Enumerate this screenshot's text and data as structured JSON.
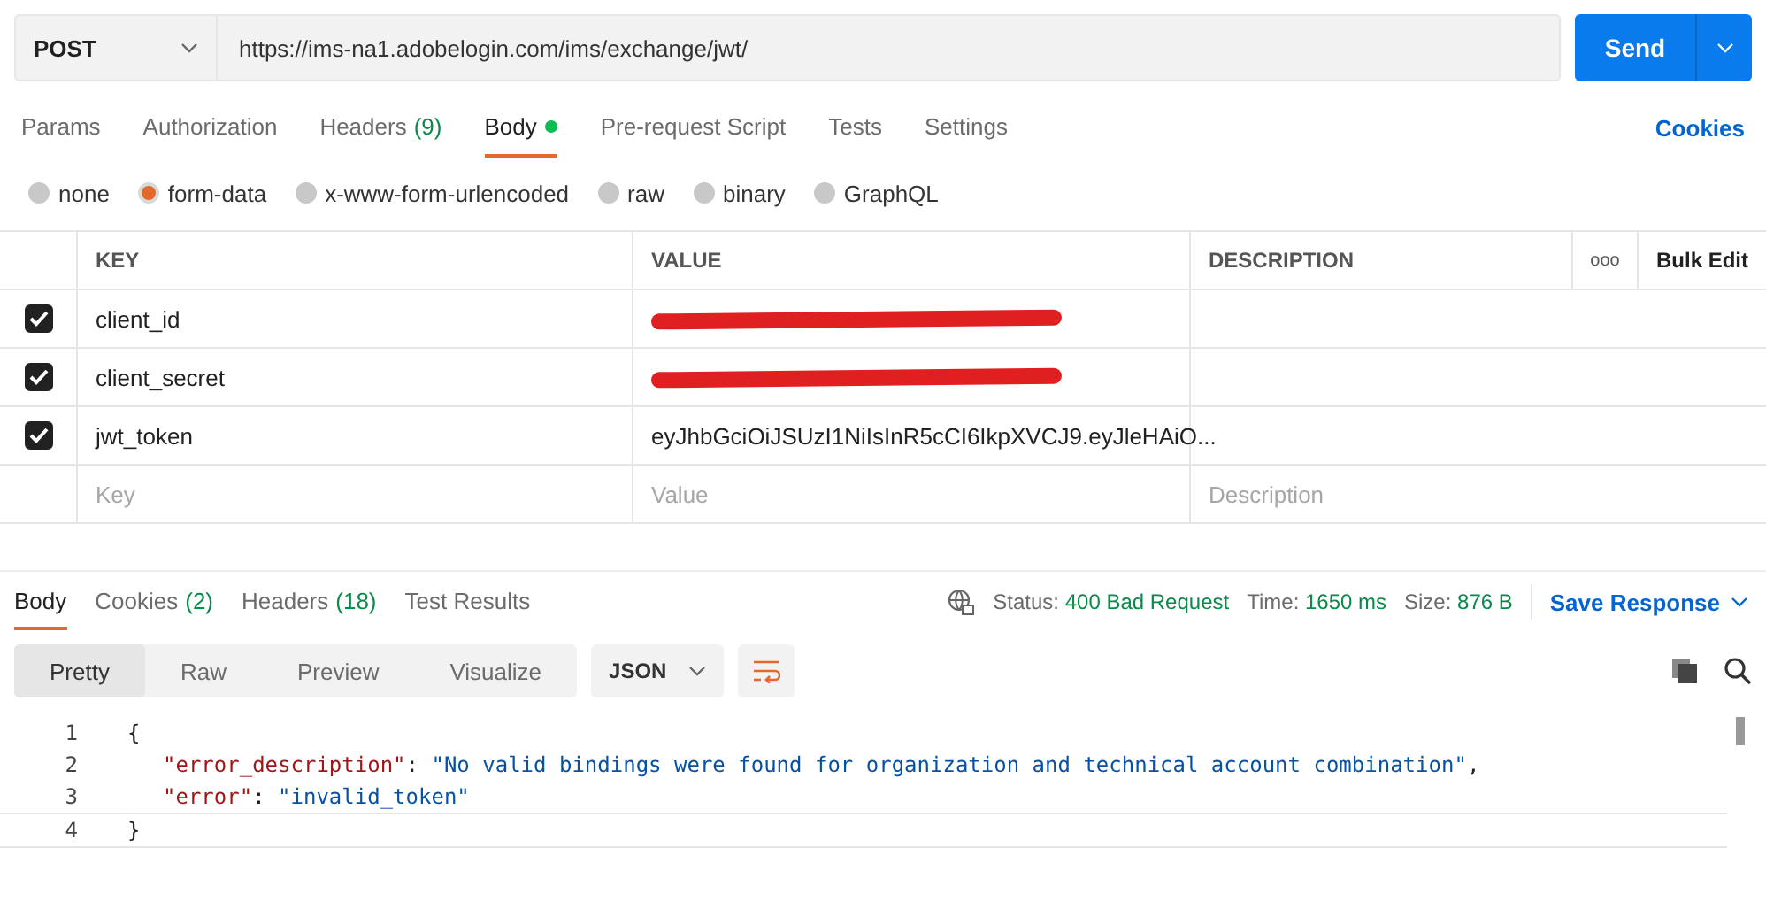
{
  "request": {
    "method": "POST",
    "url": "https://ims-na1.adobelogin.com/ims/exchange/jwt/",
    "send_label": "Send"
  },
  "request_tabs": [
    {
      "label": "Params",
      "selected": false
    },
    {
      "label": "Authorization",
      "selected": false
    },
    {
      "label": "Headers",
      "count": "(9)",
      "selected": false
    },
    {
      "label": "Body",
      "selected": true,
      "dot": true
    },
    {
      "label": "Pre-request Script",
      "selected": false
    },
    {
      "label": "Tests",
      "selected": false
    },
    {
      "label": "Settings",
      "selected": false
    }
  ],
  "cookies_link": "Cookies",
  "body_types": [
    {
      "label": "none",
      "selected": false
    },
    {
      "label": "form-data",
      "selected": true
    },
    {
      "label": "x-www-form-urlencoded",
      "selected": false
    },
    {
      "label": "raw",
      "selected": false
    },
    {
      "label": "binary",
      "selected": false
    },
    {
      "label": "GraphQL",
      "selected": false
    }
  ],
  "table": {
    "columns": [
      "KEY",
      "VALUE",
      "DESCRIPTION"
    ],
    "more": "ooo",
    "bulk_edit": "Bulk Edit",
    "rows": [
      {
        "key": "client_id",
        "checked": true,
        "redacted": true
      },
      {
        "key": "client_secret",
        "checked": true,
        "redacted": true
      },
      {
        "key": "jwt_token",
        "checked": true,
        "redacted": false,
        "value": "eyJhbGciOiJSUzI1NiIsInR5cCI6IkpXVCJ9.eyJleHAiO..."
      }
    ],
    "placeholders": {
      "key": "Key",
      "value": "Value",
      "description": "Description"
    }
  },
  "response_tabs": [
    {
      "label": "Body",
      "selected": true
    },
    {
      "label": "Cookies",
      "count": "(2)",
      "selected": false
    },
    {
      "label": "Headers",
      "count": "(18)",
      "selected": false
    },
    {
      "label": "Test Results",
      "selected": false
    }
  ],
  "status": [
    {
      "label": "Status:",
      "value": "400 Bad Request"
    },
    {
      "label": "Time:",
      "value": "1650 ms"
    },
    {
      "label": "Size:",
      "value": "876 B"
    }
  ],
  "save_response": "Save Response",
  "view_modes": [
    {
      "label": "Pretty",
      "selected": true
    },
    {
      "label": "Raw",
      "selected": false
    },
    {
      "label": "Preview",
      "selected": false
    },
    {
      "label": "Visualize",
      "selected": false
    }
  ],
  "format": "JSON",
  "code": [
    {
      "number": "1",
      "tokens": [
        {
          "kind": "punct",
          "text": "{"
        }
      ]
    },
    {
      "number": "2",
      "tokens": [
        {
          "kind": "key",
          "text": "\"error_description\""
        },
        {
          "kind": "punct",
          "text": ": "
        },
        {
          "kind": "string",
          "text": "\"No valid bindings were found for organization and technical account combination\""
        },
        {
          "kind": "punct",
          "text": ","
        }
      ]
    },
    {
      "number": "3",
      "tokens": [
        {
          "kind": "key",
          "text": "\"error\""
        },
        {
          "kind": "punct",
          "text": ": "
        },
        {
          "kind": "string",
          "text": "\"invalid_token\""
        }
      ]
    },
    {
      "number": "4",
      "tokens": [
        {
          "kind": "punct",
          "text": "}"
        }
      ]
    }
  ]
}
